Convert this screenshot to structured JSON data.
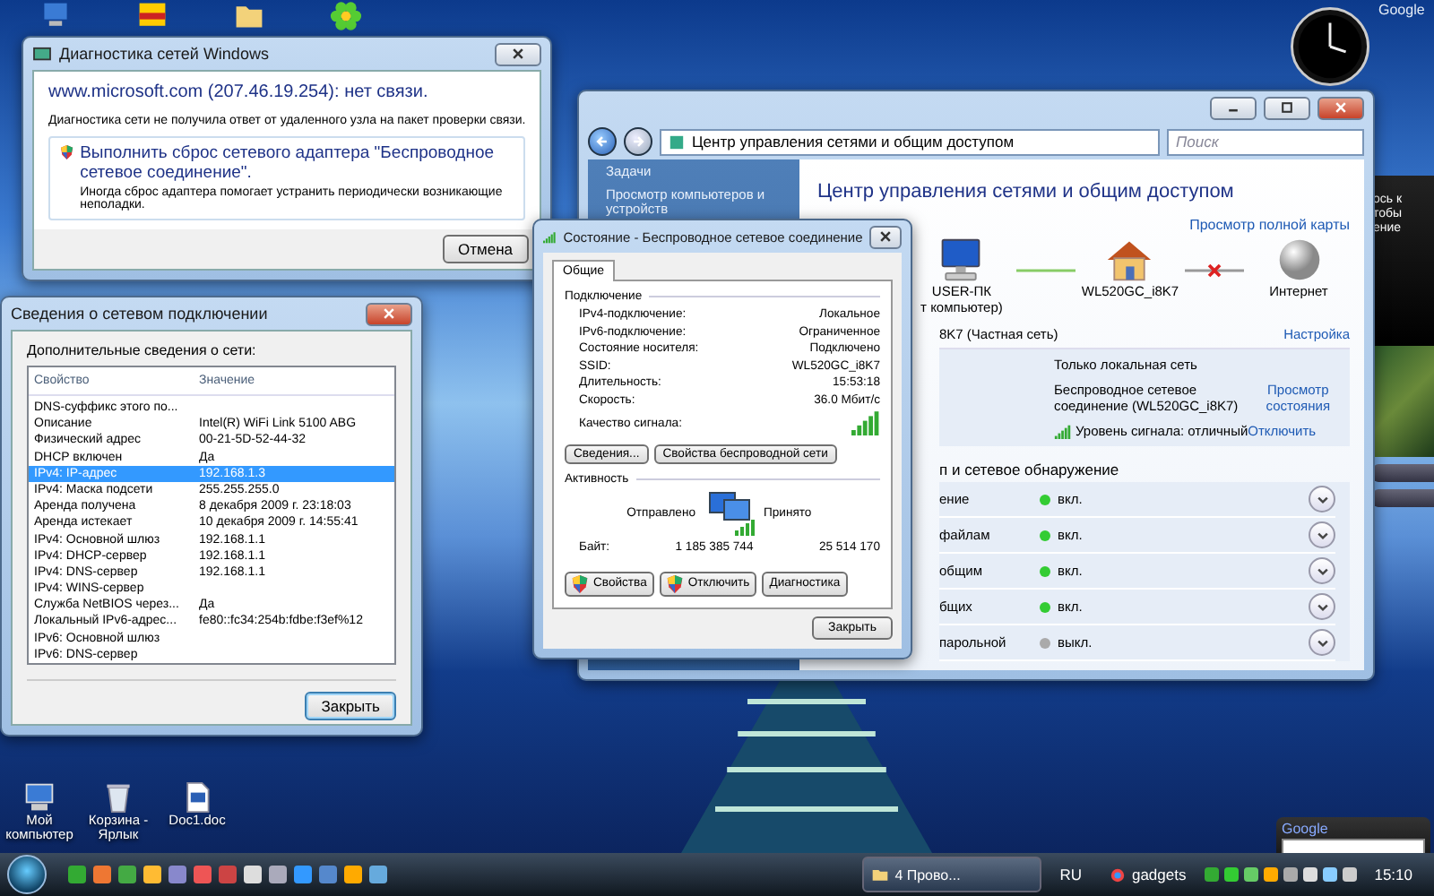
{
  "gadgets": {
    "top_label": "Google",
    "panel_texts": [
      "ось к",
      "тобы",
      "ение"
    ],
    "search_title": "Google"
  },
  "diagnostics_window": {
    "title": "Диагностика сетей Windows",
    "heading": "www.microsoft.com (207.46.19.254): нет связи.",
    "message": "Диагностика сети не получила ответ от удаленного узла на пакет проверки связи.",
    "option": {
      "title": "Выполнить сброс сетевого адаптера \"Беспроводное сетевое соединение\".",
      "description": "Иногда сброс адаптера помогает устранить периодически возникающие неполадки."
    },
    "buttons": [
      "Отмена"
    ]
  },
  "network_center": {
    "address": "Центр управления сетями и общим доступом",
    "search": {
      "placeholder": "Поиск"
    },
    "sidebar": {
      "heading": "Задачи",
      "items": [
        "Просмотр компьютеров и устройств"
      ]
    },
    "title": "Центр управления сетями и общим доступом",
    "map_link": "Просмотр полной карты",
    "map": {
      "nodes": [
        {
          "kind": "computer",
          "label": "USER-ПК",
          "sublabel": "т компьютер)"
        },
        {
          "kind": "router",
          "label": "WL520GC_i8K7"
        },
        {
          "kind": "internet",
          "label": "Интернет"
        }
      ],
      "links": [
        {
          "connected": true
        },
        {
          "connected": false
        }
      ]
    },
    "network": {
      "name": "8K7 (Частная сеть)",
      "settings_link": "Настройка",
      "access": "Только локальная сеть",
      "connection": "Беспроводное сетевое соединение (WL520GC_i8K7)",
      "status_link": "Просмотр состояния",
      "signal": "Уровень сигнала: отличный",
      "disconnect_link": "Отключить"
    },
    "sharing": {
      "heading": "п и сетевое обнаружение",
      "rows": [
        {
          "label": "ение",
          "status": "вкл.",
          "on": true
        },
        {
          "label": "файлам",
          "status": "вкл.",
          "on": true
        },
        {
          "label": "общим",
          "status": "вкл.",
          "on": true
        },
        {
          "label": "бщих",
          "status": "вкл.",
          "on": true
        },
        {
          "label": "парольной",
          "status": "выкл.",
          "on": false
        }
      ]
    }
  },
  "details_window": {
    "title": "Сведения о сетевом подключении",
    "label": "Дополнительные сведения о сети:",
    "columns": [
      "Свойство",
      "Значение"
    ],
    "rows": [
      {
        "property": "DNS-суффикс этого по...",
        "selected": false
      },
      {
        "property": "Описание",
        "value": "Intel(R) WiFi Link 5100 ABG",
        "selected": false
      },
      {
        "property": "Физический адрес",
        "value": "00-21-5D-52-44-32",
        "selected": false
      },
      {
        "property": "DHCP включен",
        "value": "Да",
        "selected": false
      },
      {
        "property": "IPv4: IP-адрес",
        "value": "192.168.1.3",
        "selected": true
      },
      {
        "property": "IPv4: Маска подсети",
        "value": "255.255.255.0",
        "selected": false
      },
      {
        "property": "Аренда получена",
        "value": "8 декабря 2009 г. 23:18:03",
        "selected": false
      },
      {
        "property": "Аренда истекает",
        "value": "10 декабря 2009 г. 14:55:41",
        "selected": false
      },
      {
        "property": "IPv4: Основной шлюз",
        "value": "192.168.1.1",
        "selected": false
      },
      {
        "property": "IPv4: DHCP-сервер",
        "value": "192.168.1.1",
        "selected": false
      },
      {
        "property": "IPv4: DNS-сервер",
        "value": "192.168.1.1",
        "selected": false
      },
      {
        "property": "IPv4: WINS-сервер",
        "selected": false
      },
      {
        "property": "Служба NetBIOS через...",
        "value": "Да",
        "selected": false
      },
      {
        "property": "Локальный IPv6-адрес...",
        "value": "fe80::fc34:254b:fdbe:f3ef%12",
        "selected": false
      },
      {
        "property": "IPv6: Основной шлюз",
        "selected": false
      },
      {
        "property": "IPv6: DNS-сервер",
        "selected": false
      }
    ],
    "buttons": [
      "Закрыть"
    ]
  },
  "status_window": {
    "title": "Состояние - Беспроводное сетевое соединение",
    "tabs": [
      {
        "label": "Общие",
        "selected": true
      }
    ],
    "connection": {
      "heading": "Подключение",
      "rows": [
        {
          "label": "IPv4-подключение:",
          "value": "Локальное"
        },
        {
          "label": "IPv6-подключение:",
          "value": "Ограниченное"
        },
        {
          "label": "Состояние носителя:",
          "value": "Подключено"
        },
        {
          "label": "SSID:",
          "value": "WL520GC_i8K7"
        },
        {
          "label": "Длительность:",
          "value": "15:53:18"
        },
        {
          "label": "Скорость:",
          "value": "36.0 Мбит/с"
        }
      ],
      "signal_label": "Качество сигнала:"
    },
    "buttons_top": [
      "Сведения...",
      "Свойства беспроводной сети"
    ],
    "activity": {
      "heading": "Активность",
      "sent_label": "Отправлено",
      "received_label": "Принято",
      "bytes_label": "Байт:",
      "sent": "1 185 385 744",
      "received": "25 514 170"
    },
    "buttons_bottom": [
      {
        "label": "Свойства",
        "shield": true
      },
      {
        "label": "Отключить",
        "shield": true
      },
      {
        "label": "Диагностика",
        "shield": false
      }
    ],
    "close_button": "Закрыть"
  },
  "desktop_icons": [
    {
      "kind": "computer",
      "label": "Мой компьютер"
    },
    {
      "kind": "recycle",
      "label": "Корзина - Ярлык"
    },
    {
      "kind": "document",
      "label": "Doc1.doc"
    }
  ],
  "taskbar": {
    "tasks": [
      {
        "label": "4 Прово...",
        "selected": false
      }
    ],
    "language": "RU",
    "toolbar": "gadgets",
    "time": "15:10"
  }
}
